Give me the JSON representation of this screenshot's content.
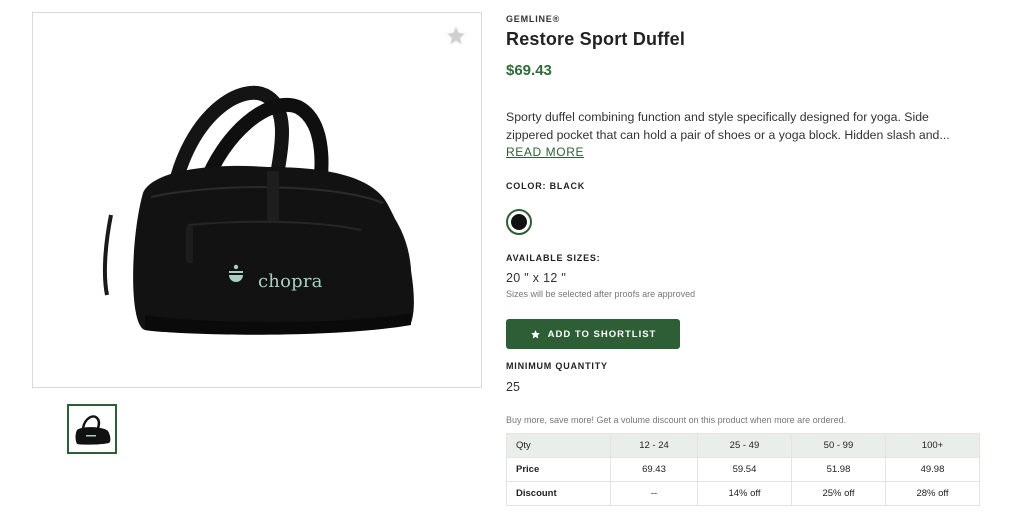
{
  "product": {
    "brand": "GEMLINE®",
    "title": "Restore Sport Duffel",
    "price": "$69.43",
    "description": "Sporty duffel combining function and style specifically designed for yoga. Side zippered pocket that can hold a pair of shoes or a yoga block. Hidden slash and...",
    "read_more_label": "READ MORE",
    "color_label": "COLOR: BLACK",
    "swatch_color": "#111111",
    "sizes_label": "AVAILABLE SIZES:",
    "size_value": "20 \" x 12 \"",
    "size_note": "Sizes will be selected after proofs are approved",
    "shortlist_label": "ADD TO SHORTLIST",
    "min_qty_label": "MINIMUM QUANTITY",
    "min_qty_value": "25",
    "volume_note": "Buy more, save more! Get a volume discount on this product when more are ordered."
  },
  "image": {
    "logo_text": "chopra",
    "favorite_icon": "star-icon"
  },
  "pricing_table": {
    "header": [
      "Qty",
      "12 - 24",
      "25 - 49",
      "50 - 99",
      "100+"
    ],
    "rows": [
      [
        "Price",
        "69.43",
        "59.54",
        "51.98",
        "49.98"
      ],
      [
        "Discount",
        "--",
        "14% off",
        "25% off",
        "28% off"
      ]
    ]
  },
  "colors": {
    "accent": "#2e5e35",
    "price": "#2e6b3a",
    "logo": "#a9cfc3"
  }
}
